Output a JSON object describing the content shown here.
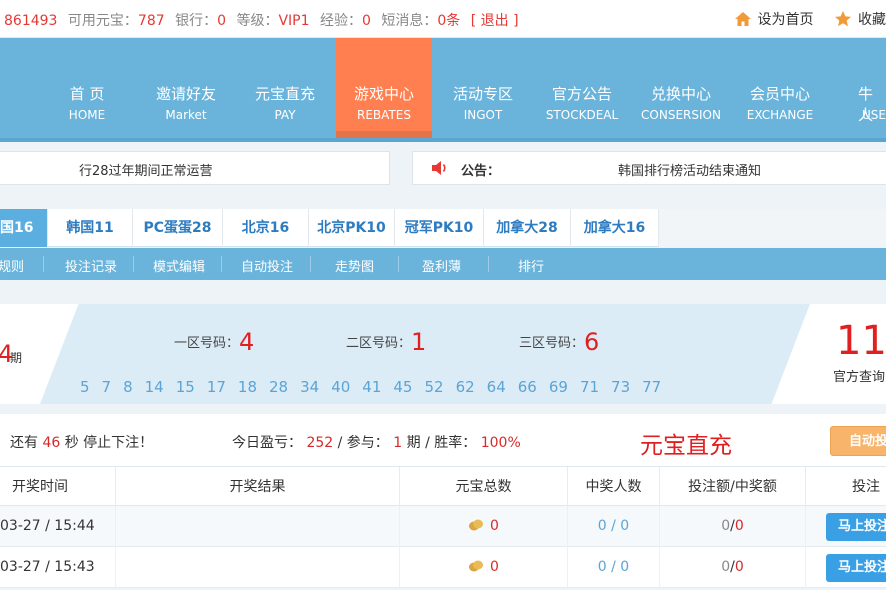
{
  "topbar": {
    "user_id": "861493",
    "balance_label": "可用元宝：",
    "balance_value": "787",
    "bank_label": "银行：",
    "bank_value": "0",
    "level_label": "等级：",
    "level_value": "VIP1",
    "exp_label": "经验：",
    "exp_value": "0",
    "msg_label": "短消息：",
    "msg_value": "0条",
    "logout": "[ 退出 ]",
    "set_home": "设为首页",
    "favorite": "收藏"
  },
  "nav": [
    {
      "zh": "首 页",
      "en": "HOME"
    },
    {
      "zh": "邀请好友",
      "en": "Market"
    },
    {
      "zh": "元宝直充",
      "en": "PAY"
    },
    {
      "zh": "游戏中心",
      "en": "REBATES",
      "active": true
    },
    {
      "zh": "活动专区",
      "en": "INGOT"
    },
    {
      "zh": "官方公告",
      "en": "STOCKDEAL"
    },
    {
      "zh": "兑换中心",
      "en": "CONSERSION"
    },
    {
      "zh": "会员中心",
      "en": "EXCHANGE"
    },
    {
      "zh": "牛人",
      "en": "USE"
    }
  ],
  "ticker": {
    "left_text": "行28过年期间正常运营",
    "notice_label": "公告：",
    "notice_text": "韩国排行榜活动结束通知"
  },
  "game_tabs": [
    "国16",
    "韩国11",
    "PC蛋蛋28",
    "北京16",
    "北京PK10",
    "冠军PK10",
    "加拿大28",
    "加拿大16"
  ],
  "sub_nav": [
    "规则",
    "投注记录",
    "模式编辑",
    "自动投注",
    "走势图",
    "盈利薄",
    "排行"
  ],
  "result": {
    "period_suffix": "4",
    "period_label": "期",
    "zone1_label": "一区号码：",
    "zone1_value": "4",
    "zone2_label": "二区号码：",
    "zone2_value": "1",
    "zone3_label": "三区号码：",
    "zone3_value": "6",
    "numbers": [
      "5",
      "7",
      "8",
      "14",
      "15",
      "17",
      "18",
      "28",
      "34",
      "40",
      "41",
      "45",
      "52",
      "62",
      "64",
      "66",
      "69",
      "71",
      "73",
      "77"
    ],
    "right_big": "11",
    "right_label": "官方查询"
  },
  "info": {
    "countdown_prefix": "还有",
    "countdown_value": "46",
    "countdown_suffix": "秒 停止下注！",
    "today_label": "今日盈亏：",
    "today_value": "252",
    "join_label": "/ 参与：",
    "join_value": "1",
    "rate_label": "期 / 胜率：",
    "rate_value": "100%",
    "promo": "元宝直充",
    "auto_button": "自动投"
  },
  "table": {
    "headers": [
      "开奖时间",
      "开奖结果",
      "元宝总数",
      "中奖人数",
      "投注额/中奖额",
      "投注"
    ],
    "rows": [
      {
        "time": "03-27 / 15:44",
        "total": "0",
        "winners": "0 / 0",
        "bet_a": "0",
        "bet_b": "0",
        "action": "马上投注"
      },
      {
        "time": "03-27 / 15:43",
        "total": "0",
        "winners": "0 / 0",
        "bet_a": "0",
        "bet_b": "0",
        "action": "马上投注"
      }
    ]
  }
}
